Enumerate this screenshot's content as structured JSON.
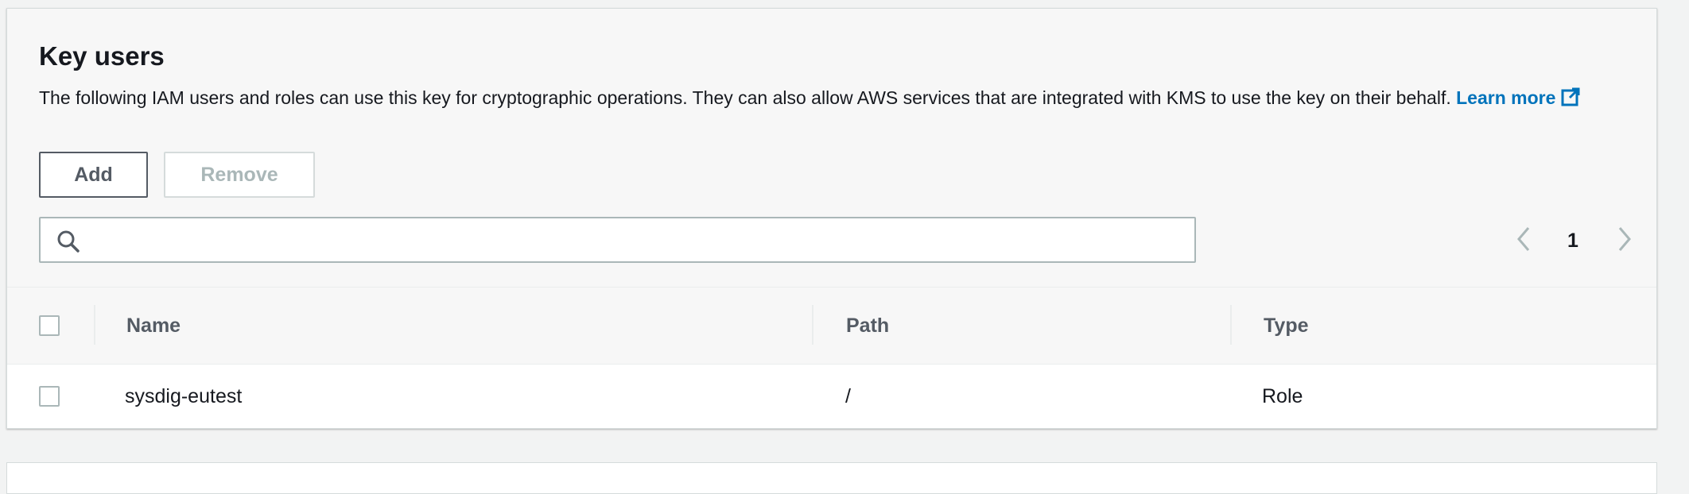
{
  "section": {
    "title": "Key users",
    "description": "The following IAM users and roles can use this key for cryptographic operations. They can also allow AWS services that are integrated with KMS to use the key on their behalf.",
    "learn_more_label": "Learn more",
    "learn_more_icon": "external-link-icon"
  },
  "toolbar": {
    "add_label": "Add",
    "remove_label": "Remove"
  },
  "search": {
    "placeholder": "",
    "value": "",
    "icon": "search-icon"
  },
  "pagination": {
    "current_page": "1",
    "prev_icon": "chevron-left-icon",
    "next_icon": "chevron-right-icon"
  },
  "table": {
    "columns": [
      "Name",
      "Path",
      "Type"
    ],
    "rows": [
      {
        "name": "sysdig-eutest",
        "path": "/",
        "type": "Role"
      }
    ]
  },
  "colors": {
    "link": "#0073bb",
    "text": "#16191f",
    "secondary_text": "#545b64",
    "disabled_text": "#aab7b8",
    "border": "#aab7b8"
  }
}
